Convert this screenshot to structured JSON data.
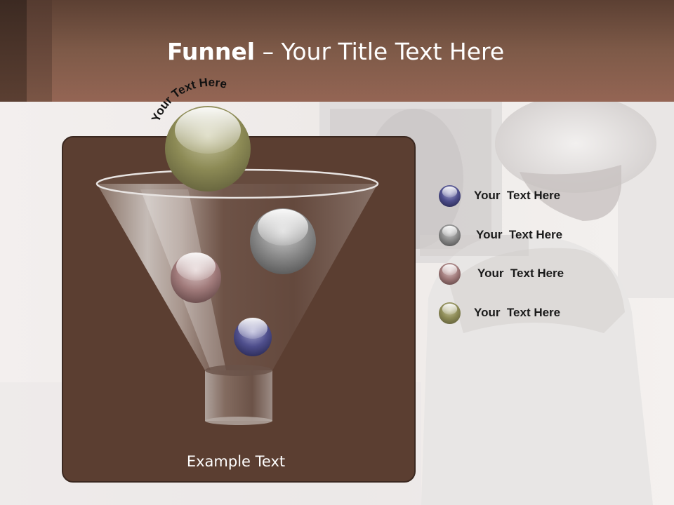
{
  "slide": {
    "title_bold": "Funnel",
    "title_rest": " – Your Title Text Here",
    "arc_text": "Your Text Here",
    "example_text": "Example Text"
  },
  "legend": [
    {
      "label": "Your  Text Here",
      "color": "#4a4a8a"
    },
    {
      "label": "Your  Text Here",
      "color": "#7a7a7a"
    },
    {
      "label": "Your  Text Here",
      "color": "#8a6a6a"
    },
    {
      "label": "Your  Text Here",
      "color": "#7a7a4a"
    }
  ],
  "colors": {
    "header": "#7e5a48",
    "panel": "#5b3e31",
    "ball_olive": "#8c8a55",
    "ball_gray": "#8a8a8a",
    "ball_rose": "#a07a7a",
    "ball_blue": "#4e4e8c"
  }
}
